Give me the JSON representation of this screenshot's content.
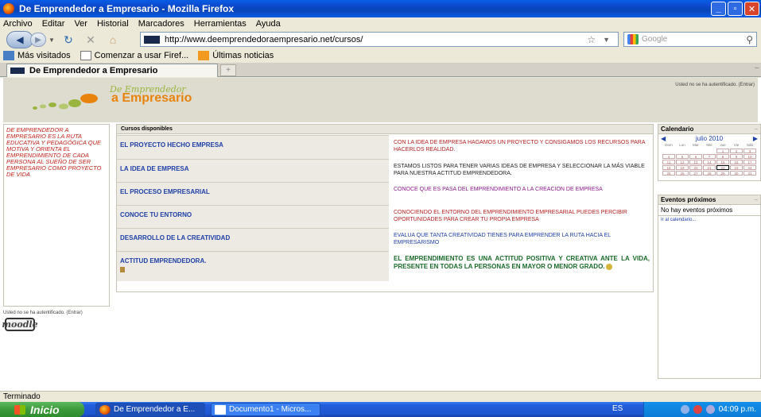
{
  "window": {
    "title": "De Emprendedor a Empresario - Mozilla Firefox",
    "minimize": "_",
    "maximize": "▫",
    "close": "✕"
  },
  "menu": [
    "Archivo",
    "Editar",
    "Ver",
    "Historial",
    "Marcadores",
    "Herramientas",
    "Ayuda"
  ],
  "nav": {
    "url": "http://www.deemprendedoraempresario.net/cursos/",
    "search_placeholder": "Google"
  },
  "bookmarks": [
    "Más visitados",
    "Comenzar a usar Firef...",
    "Últimas noticias"
  ],
  "tab": {
    "title": "De Emprendedor a Empresario"
  },
  "page": {
    "logo_line1": "De Emprendedor",
    "logo_line2": "a Empresario",
    "auth_top": "Usted no se ha autentificado. (Entrar)",
    "intro": "DE EMPRENDEDOR A EMPRESARIO ES LA RUTA EDUCATIVA Y PEDAGÓGICA QUE MOTIVA Y ORIENTA EL EMPRENDIMIENTO DE CADA PERSONA AL SUEÑO DE SER EMPRESARIO COMO PROYECTO DE VIDA",
    "courses_header": "Cursos disponibles",
    "courses": [
      {
        "name": "EL PROYECTO HECHO EMPRESA",
        "desc": "CON LA IDEA DE EMPRESA HAGAMOS UN PROYECTO Y CONSIGAMOS LOS RECURSOS PARA HACERLOS REALIDAD."
      },
      {
        "name": "LA IDEA DE EMPRESA",
        "desc": "ESTAMOS LISTOS PARA TENER VARIAS IDEAS DE EMPRESA Y SELECCIONAR LA MÁS VIABLE PARA NUESTRA ACTITUD EMPRENDEDORA."
      },
      {
        "name": "EL PROCESO EMPRESARIAL",
        "desc": "CONOCE QUE ES PASA DEL EMPRENDIMIENTO A LA CREACION DE EMPRESA"
      },
      {
        "name": "CONOCE TU ENTORNO",
        "desc": "CONOCIENDO EL ENTORNO DEL EMPRENDIMIENTO EMPRESARIAL PUEDES PERCIBIR OPORTUNIDADES PARA CREAR TU PROPIA EMPRESA"
      },
      {
        "name": "DESARROLLO DE LA CREATIVIDAD",
        "desc": "EVALUA QUE TANTA CREATIVIDAD TIENES PARA EMPRENDER LA RUTA HACIA EL EMPRESARISMO"
      },
      {
        "name": "ACTITUD EMPRENDEDORA.",
        "desc": "EL EMPRENDIMIENTO ES UNA ACTITUD POSITIVA Y CREATIVA ANTE LA VIDA, PRESENTE EN TODAS LA PERSONAS EN MAYOR O MENOR GRADO."
      }
    ],
    "calendar": {
      "title": "Calendario",
      "month": "julio 2010",
      "weekdays": [
        "Dom",
        "Lun",
        "Mar",
        "Mié",
        "Jue",
        "Vie",
        "Sáb"
      ],
      "days": [
        "",
        "",
        "",
        "",
        "1",
        "2",
        "3",
        "4",
        "5",
        "6",
        "7",
        "8",
        "9",
        "10",
        "11",
        "12",
        "13",
        "14",
        "15",
        "16",
        "17",
        "18",
        "19",
        "20",
        "21",
        "22",
        "23",
        "24",
        "25",
        "26",
        "27",
        "28",
        "29",
        "30",
        "31"
      ],
      "today": "22"
    },
    "events": {
      "title": "Eventos próximos",
      "none": "No hay eventos próximos",
      "link": "Ir al calendario..."
    },
    "auth_bottom": "Usted no se ha autentificado. (Entrar)",
    "moodle": "moodle"
  },
  "status": "Terminado",
  "taskbar": {
    "start": "Inicio",
    "items": [
      "De Emprendedor a E...",
      "Documento1 - Micros..."
    ],
    "lang": "ES",
    "time": "04:09 p.m."
  }
}
